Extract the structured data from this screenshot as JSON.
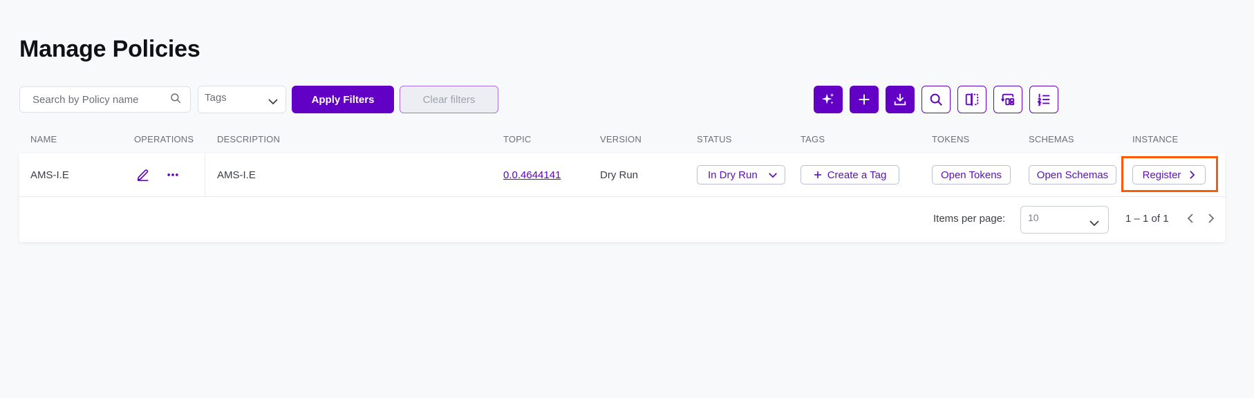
{
  "page": {
    "title": "Manage Policies"
  },
  "toolbar": {
    "search_placeholder": "Search by Policy name",
    "tags_placeholder": "Tags",
    "apply_label": "Apply Filters",
    "clear_label": "Clear filters",
    "icon_buttons": [
      "sparkle-icon",
      "plus-icon",
      "download-icon",
      "search-icon",
      "split-view-icon",
      "switch-layout-icon",
      "numbered-list-icon"
    ]
  },
  "table": {
    "headers": {
      "name": "NAME",
      "operations": "OPERATIONS",
      "description": "DESCRIPTION",
      "topic": "TOPIC",
      "version": "VERSION",
      "status": "STATUS",
      "tags": "TAGS",
      "tokens": "TOKENS",
      "schemas": "SCHEMAS",
      "instance": "INSTANCE"
    },
    "rows": [
      {
        "name": "AMS-I.E",
        "description": "AMS-I.E",
        "topic": "0.0.4644141",
        "version": "Dry Run",
        "status": "In Dry Run",
        "tags_button": "Create a Tag",
        "tokens_button": "Open Tokens",
        "schemas_button": "Open Schemas",
        "instance_button": "Register"
      }
    ]
  },
  "pagination": {
    "items_per_page_label": "Items per page:",
    "items_per_page_value": "10",
    "range": "1 – 1 of 1"
  },
  "colors": {
    "brand": "#6300c6",
    "highlight": "#ff5a00",
    "background": "#f8f9fb"
  }
}
